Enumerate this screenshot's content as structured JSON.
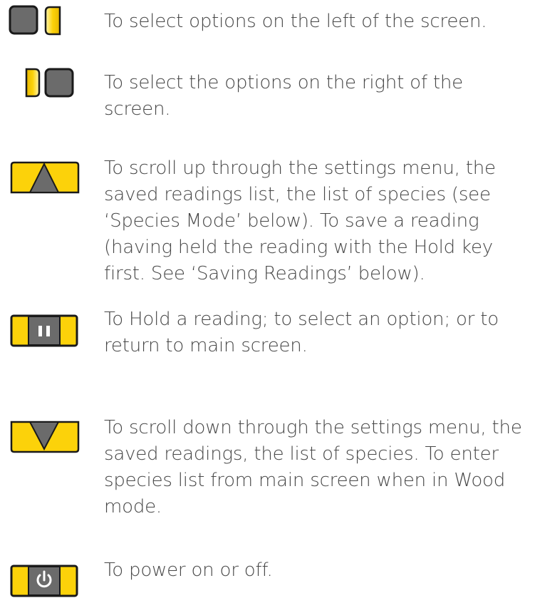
{
  "colors": {
    "key_yellow": "#fcd20a",
    "key_grey": "#6b6b6b",
    "key_outline": "#1a1a1a",
    "text": "#474747"
  },
  "keys": [
    {
      "icon": "left-soft-key-icon",
      "description": "To select options on the left of the screen."
    },
    {
      "icon": "right-soft-key-icon",
      "description": "To select the options on the right of the screen."
    },
    {
      "icon": "up-arrow-key-icon",
      "description": "To scroll up through the settings menu, the saved readings list, the list of species (see ‘Species Mode’ below). To save a reading (having held the reading with the Hold key first. See ‘Saving Readings’ below)."
    },
    {
      "icon": "hold-key-icon",
      "description": "To Hold a reading; to select an option; or to return to main screen."
    },
    {
      "icon": "down-arrow-key-icon",
      "description": "To scroll down through the settings menu, the saved readings, the list of species. To enter species list from main screen when in Wood mode."
    },
    {
      "icon": "power-key-icon",
      "description": "To power on or off."
    }
  ]
}
